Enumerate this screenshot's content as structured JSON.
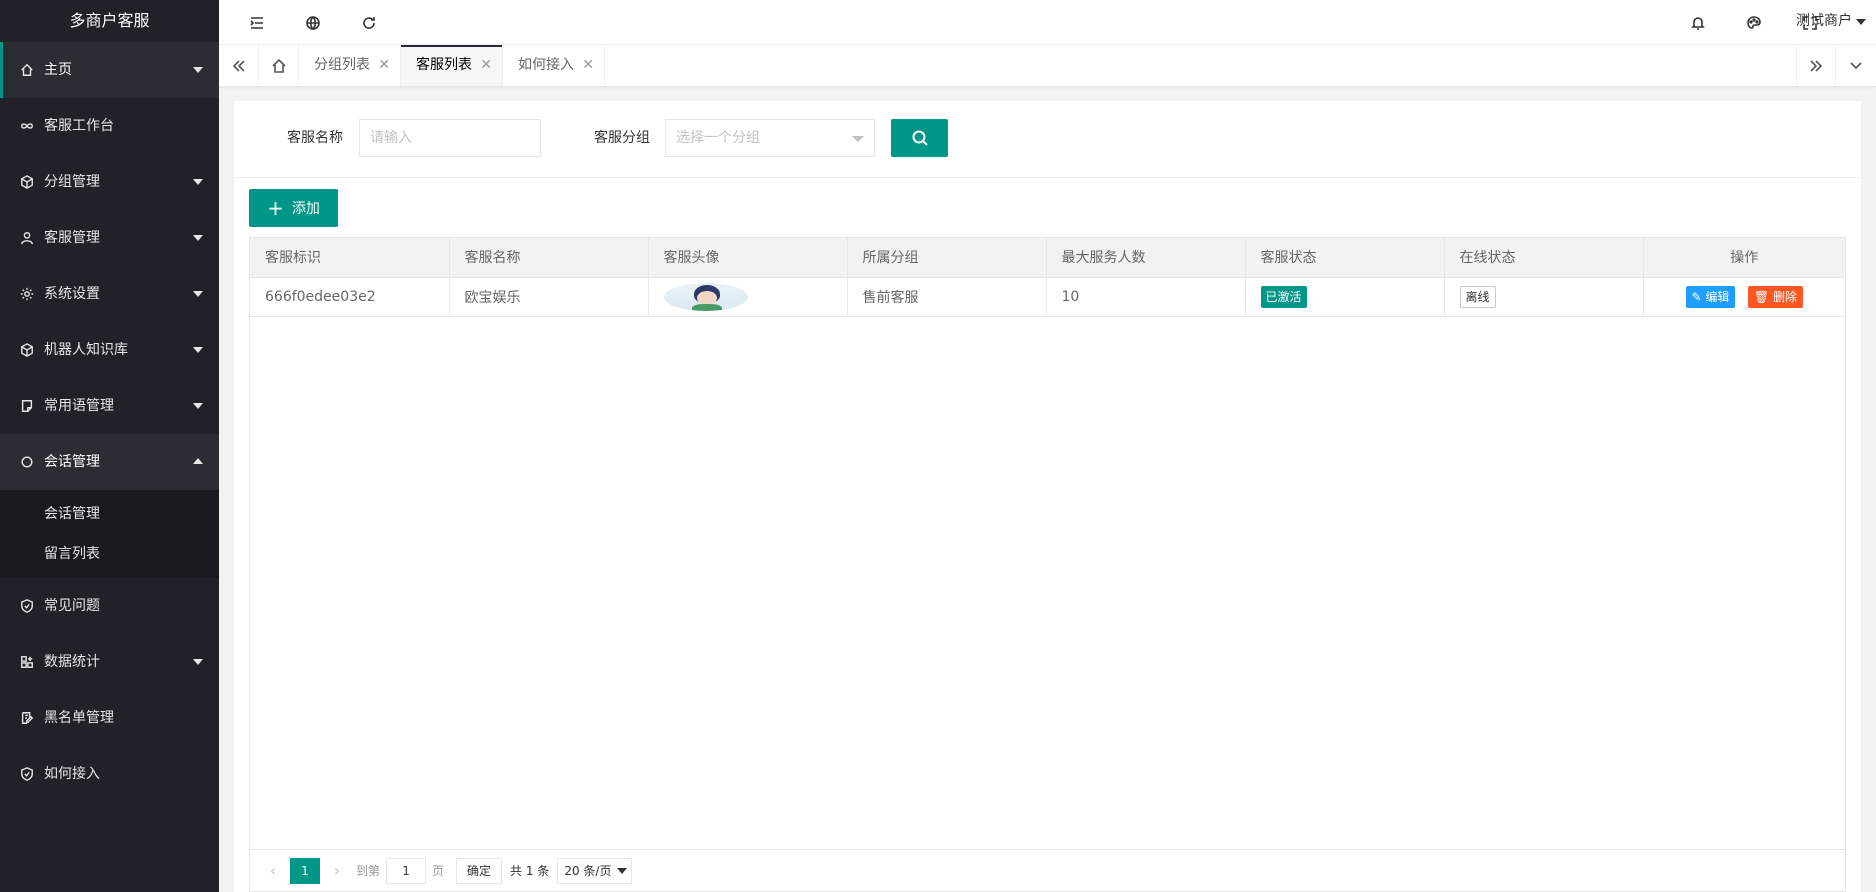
{
  "brand": "多商户客服",
  "sidebar": {
    "items": [
      {
        "label": "主页"
      },
      {
        "label": "客服工作台"
      },
      {
        "label": "分组管理"
      },
      {
        "label": "客服管理"
      },
      {
        "label": "系统设置"
      },
      {
        "label": "机器人知识库"
      },
      {
        "label": "常用语管理"
      },
      {
        "label": "会话管理"
      },
      {
        "label": "常见问题"
      },
      {
        "label": "数据统计"
      },
      {
        "label": "黑名单管理"
      },
      {
        "label": "如何接入"
      }
    ],
    "submenu": [
      "会话管理",
      "留言列表"
    ]
  },
  "header": {
    "user": "测试商户"
  },
  "tabs": [
    {
      "label": "分组列表"
    },
    {
      "label": "客服列表"
    },
    {
      "label": "如何接入"
    }
  ],
  "search": {
    "name_label": "客服名称",
    "name_placeholder": "请输入",
    "group_label": "客服分组",
    "group_placeholder": "选择一个分组"
  },
  "add_button": "添加",
  "table": {
    "headers": [
      "客服标识",
      "客服名称",
      "客服头像",
      "所属分组",
      "最大服务人数",
      "客服状态",
      "在线状态",
      "操作"
    ],
    "rows": [
      {
        "id": "666f0edee03e2",
        "name": "欧宝娱乐",
        "group": "售前客服",
        "max": "10",
        "status": "已激活",
        "online": "离线",
        "edit": "编辑",
        "delete": "删除"
      }
    ]
  },
  "pager": {
    "current": "1",
    "goto_label": "到第",
    "page_value": "1",
    "page_suffix": "页",
    "confirm": "确定",
    "total": "共 1 条",
    "per_page": "20 条/页"
  },
  "colors": {
    "primary": "#009688",
    "sidebar": "#20222a",
    "edit": "#1e9fff",
    "delete": "#ff5722"
  }
}
